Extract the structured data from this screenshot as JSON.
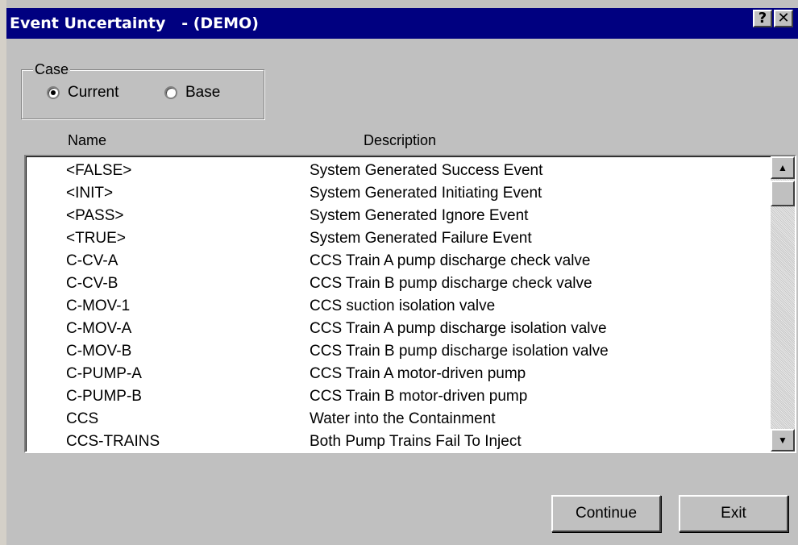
{
  "window": {
    "title": "Event Uncertainty   - (DEMO)",
    "help_glyph": "?",
    "close_glyph": "✕"
  },
  "case": {
    "legend": "Case",
    "options": [
      {
        "label": "Current",
        "selected": true
      },
      {
        "label": "Base",
        "selected": false
      }
    ]
  },
  "list": {
    "headers": {
      "name": "Name",
      "description": "Description"
    },
    "rows": [
      {
        "name": "<FALSE>",
        "description": "System Generated Success Event"
      },
      {
        "name": "<INIT>",
        "description": "System Generated Initiating Event"
      },
      {
        "name": "<PASS>",
        "description": "System Generated Ignore Event"
      },
      {
        "name": "<TRUE>",
        "description": "System Generated Failure Event"
      },
      {
        "name": "C-CV-A",
        "description": "CCS Train A pump discharge check valve"
      },
      {
        "name": "C-CV-B",
        "description": "CCS Train B pump discharge check valve"
      },
      {
        "name": "C-MOV-1",
        "description": "CCS suction isolation valve"
      },
      {
        "name": "C-MOV-A",
        "description": "CCS Train A pump discharge isolation valve"
      },
      {
        "name": "C-MOV-B",
        "description": "CCS Train B pump discharge isolation valve"
      },
      {
        "name": "C-PUMP-A",
        "description": "CCS Train A motor-driven pump"
      },
      {
        "name": "C-PUMP-B",
        "description": "CCS Train B motor-driven pump"
      },
      {
        "name": "CCS",
        "description": "Water into the Containment"
      },
      {
        "name": "CCS-TRAINS",
        "description": "Both Pump Trains Fail To Inject"
      }
    ]
  },
  "buttons": {
    "continue": "Continue",
    "exit": "Exit"
  },
  "colors": {
    "titlebar": "#000080",
    "face": "#c0c0c0"
  }
}
